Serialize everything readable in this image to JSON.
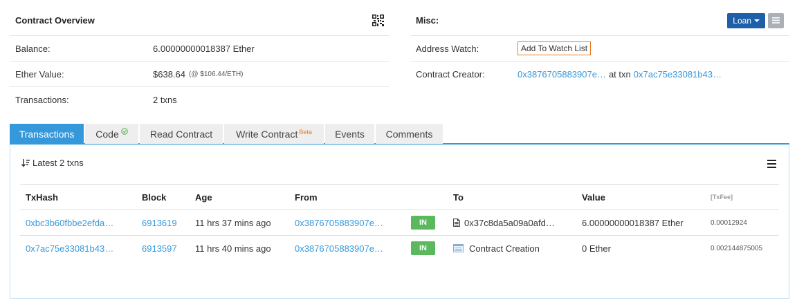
{
  "overview": {
    "title": "Contract Overview",
    "qr_icon": "qr-code-icon",
    "rows": [
      {
        "label": "Balance:",
        "value": "6.00000000018387 Ether",
        "extra": ""
      },
      {
        "label": "Ether Value:",
        "value": "$638.64",
        "extra": "(@ $106.44/ETH)"
      },
      {
        "label": "Transactions:",
        "value": "2 txns",
        "extra": ""
      }
    ]
  },
  "misc": {
    "title": "Misc:",
    "loan_label": "Loan",
    "address_watch_label": "Address Watch:",
    "watch_button": "Add To Watch List",
    "creator_label": "Contract Creator:",
    "creator_address": "0x3876705883907e…",
    "creator_at_txn": "at txn",
    "creator_txn": "0x7ac75e33081b43…"
  },
  "tabs": [
    {
      "label": "Transactions",
      "active": true,
      "sup": ""
    },
    {
      "label": "Code",
      "active": false,
      "sup": ""
    },
    {
      "label": "Read Contract",
      "active": false,
      "sup": ""
    },
    {
      "label": "Write Contract",
      "active": false,
      "sup": "Beta"
    },
    {
      "label": "Events",
      "active": false,
      "sup": ""
    },
    {
      "label": "Comments",
      "active": false,
      "sup": ""
    }
  ],
  "txns": {
    "latest_label": "Latest 2 txns",
    "columns": [
      "TxHash",
      "Block",
      "Age",
      "From",
      "",
      "To",
      "Value",
      "[TxFee]"
    ],
    "rows": [
      {
        "hash": "0xbc3b60fbbe2efda…",
        "block": "6913619",
        "age": "11 hrs 37 mins ago",
        "from": "0x3876705883907e…",
        "direction": "IN",
        "to": "0x37c8da5a09a0afd…",
        "to_icon": "contract-file-icon",
        "value": "6.00000000018387 Ether",
        "fee": "0.00012924"
      },
      {
        "hash": "0x7ac75e33081b43…",
        "block": "6913597",
        "age": "11 hrs 40 mins ago",
        "from": "0x3876705883907e…",
        "direction": "IN",
        "to": "Contract Creation",
        "to_icon": "contract-creation-icon",
        "value": "0 Ether",
        "fee": "0.002144875005"
      }
    ]
  },
  "colors": {
    "link": "#3498db",
    "tab_active": "#3498db",
    "badge_in": "#5cb85c",
    "loan_button": "#1e5fa8",
    "watch_border": "#e8791f"
  }
}
